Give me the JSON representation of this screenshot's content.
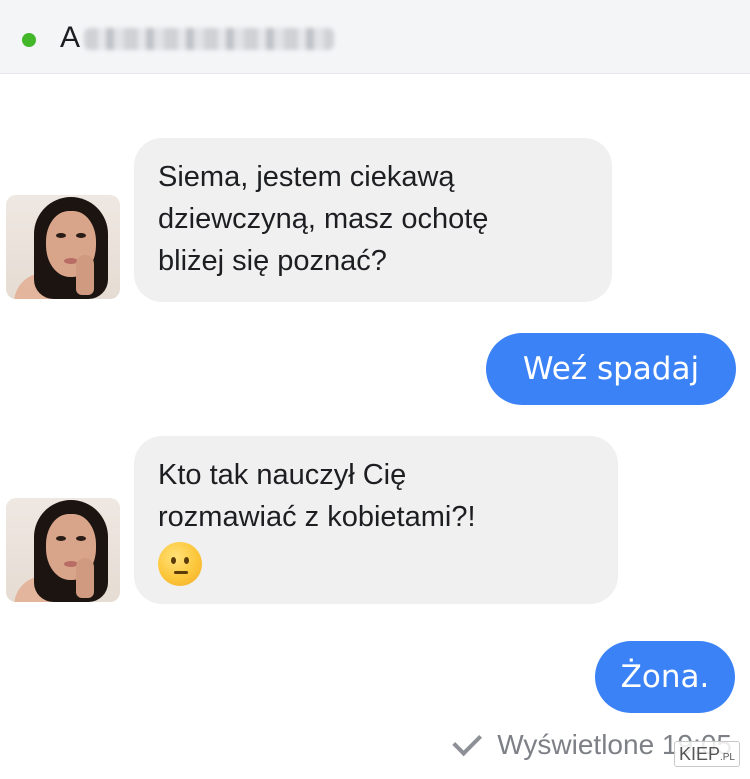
{
  "header": {
    "online": true,
    "contact_initial": "A"
  },
  "messages": [
    {
      "direction": "incoming",
      "lines": [
        "Siema, jestem ciekawą",
        "dziewczyną, masz ochotę",
        "bliżej się poznać?"
      ]
    },
    {
      "direction": "outgoing",
      "text": "Weź spadaj"
    },
    {
      "direction": "incoming",
      "lines": [
        "Kto tak nauczył Cię",
        "rozmawiać z kobietami?!"
      ],
      "emoji": "confused-face-emoji"
    },
    {
      "direction": "outgoing",
      "text": "Żona."
    }
  ],
  "status": {
    "seen_text": "Wyświetlone 19:05"
  },
  "watermark": {
    "main": "KIEP",
    "suffix": ".PL"
  },
  "colors": {
    "outgoing_bubble": "#3b82f6",
    "incoming_bubble": "#f1f0f0",
    "online_dot": "#42b72a"
  }
}
